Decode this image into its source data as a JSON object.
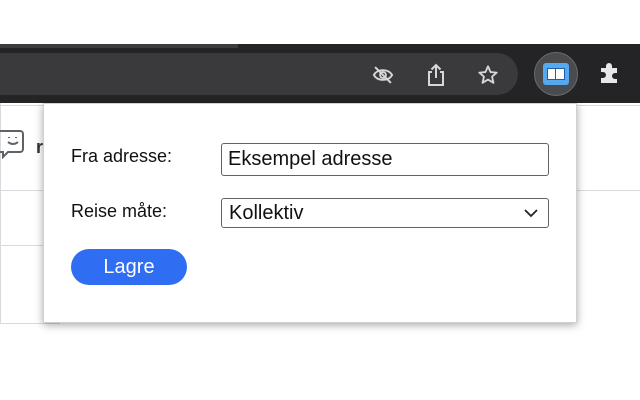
{
  "toolbar": {
    "icons": [
      "eye-off-icon",
      "share-icon",
      "star-icon"
    ],
    "extensions": [
      "extension-active-icon",
      "puzzle-icon"
    ]
  },
  "background_page": {
    "partial_text": "r"
  },
  "popup": {
    "from_label": "Fra adresse:",
    "from_value": "Eksempel adresse",
    "mode_label": "Reise måte:",
    "mode_value": "Kollektiv",
    "save_label": "Lagre"
  },
  "colors": {
    "toolbar_bg": "#242426",
    "omnibox_bg": "#3a3a3c",
    "button_blue": "#2f6df3",
    "extension_blue": "#55a9ee"
  }
}
